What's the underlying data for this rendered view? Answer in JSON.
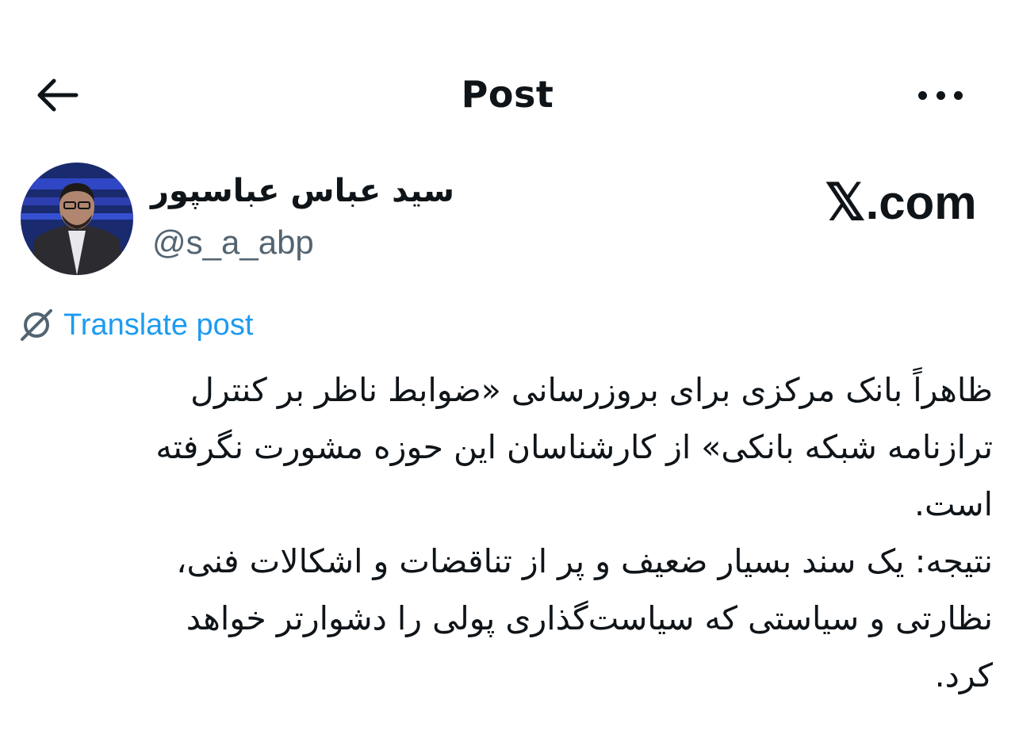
{
  "header": {
    "title": "Post",
    "back_icon": "arrow-left-icon",
    "more_icon": "more-horizontal-icon"
  },
  "author": {
    "name": "سید عباس عباسپور",
    "handle": "@s_a_abp"
  },
  "site_mark": {
    "x": "𝕏",
    "domain": ".com"
  },
  "translate": {
    "label": "Translate post",
    "icon": "translate-globe-icon",
    "color": "#1d9bf0"
  },
  "post": {
    "lines": [
      "ظاهراً بانک مرکزی برای بروزرسانی «ضوابط ناظر بر کنترل",
      "ترازنامه شبکه بانکی» از کارشناسان این حوزه مشورت نگرفته",
      "است.",
      "نتیجه: یک سند بسیار ضعیف و پر از تناقضات و اشکالات فنی،",
      "نظارتی و سیاستی که سیاست‌گذاری پولی را دشوارتر خواهد",
      "کرد."
    ]
  },
  "colors": {
    "text": "#0f1419",
    "secondary": "#536471",
    "accent": "#1d9bf0"
  }
}
